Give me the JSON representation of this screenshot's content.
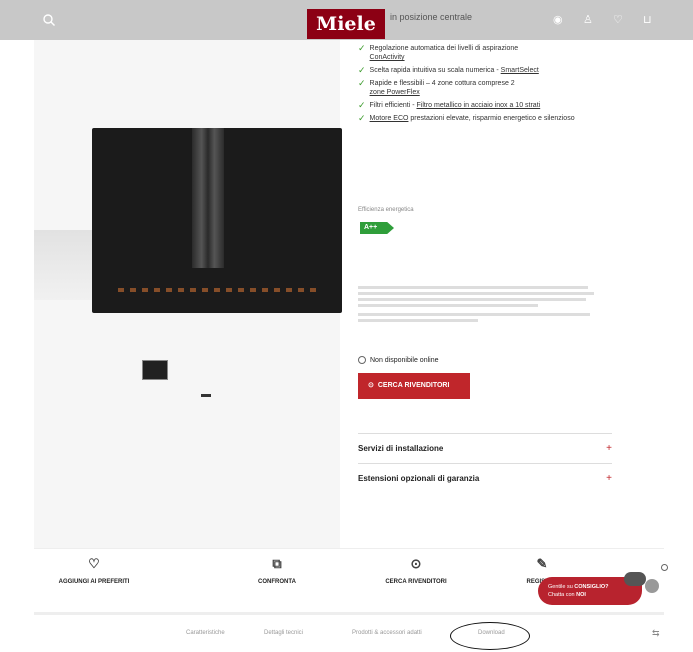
{
  "header": {
    "brand": "Miele",
    "tagline": "in posizione centrale",
    "icons": [
      "search-icon",
      "pin-icon",
      "user-icon",
      "heart-icon",
      "cart-icon"
    ]
  },
  "features": [
    {
      "text": "Regolazione automatica dei livelli di aspirazione",
      "link": "ConActivity"
    },
    {
      "text": "Scelta rapida intuitiva su scala numerica - ",
      "link": "SmartSelect"
    },
    {
      "text": "Rapide e flessibili – 4 zone cottura comprese 2",
      "link": "zone PowerFlex"
    },
    {
      "text": "Filtri efficienti - ",
      "link": "Filtro metallico in acciaio inox a 10 strati"
    },
    {
      "text": " prestazioni elevate, risparmio energetico e silenzioso",
      "link": "Motore ECO"
    }
  ],
  "energy": {
    "label": "Efficienza energetica",
    "class": "A++"
  },
  "availability": "Non disponibile online",
  "dealer_button": "CERCA RIVENDITORI",
  "accordion": [
    {
      "label": "Servizi di installazione"
    },
    {
      "label": "Estensioni opzionali di garanzia"
    }
  ],
  "actions": [
    {
      "label": "AGGIUNGI AI PREFERITI",
      "icon": "heart-icon"
    },
    {
      "label": "CONFRONTA",
      "icon": "compare-icon"
    },
    {
      "label": "CERCA RIVENDITORI",
      "icon": "location-icon"
    },
    {
      "label": "REGISTRA",
      "icon": "edit-icon"
    }
  ],
  "chat": {
    "line1_prefix": "Gentile su ",
    "line1_bold": "CONSIGLIO?",
    "line2_prefix": "Chatta con ",
    "line2_bold": "NOI"
  },
  "bottom_nav": [
    "Caratteristiche",
    "Dettagli tecnici",
    "Prodotti & accessori adatti",
    "Download"
  ],
  "colors": {
    "brand_red": "#8c0014",
    "button_red": "#c0262b",
    "check_green": "#3a9a2a",
    "energy_green": "#2f9e3a"
  }
}
